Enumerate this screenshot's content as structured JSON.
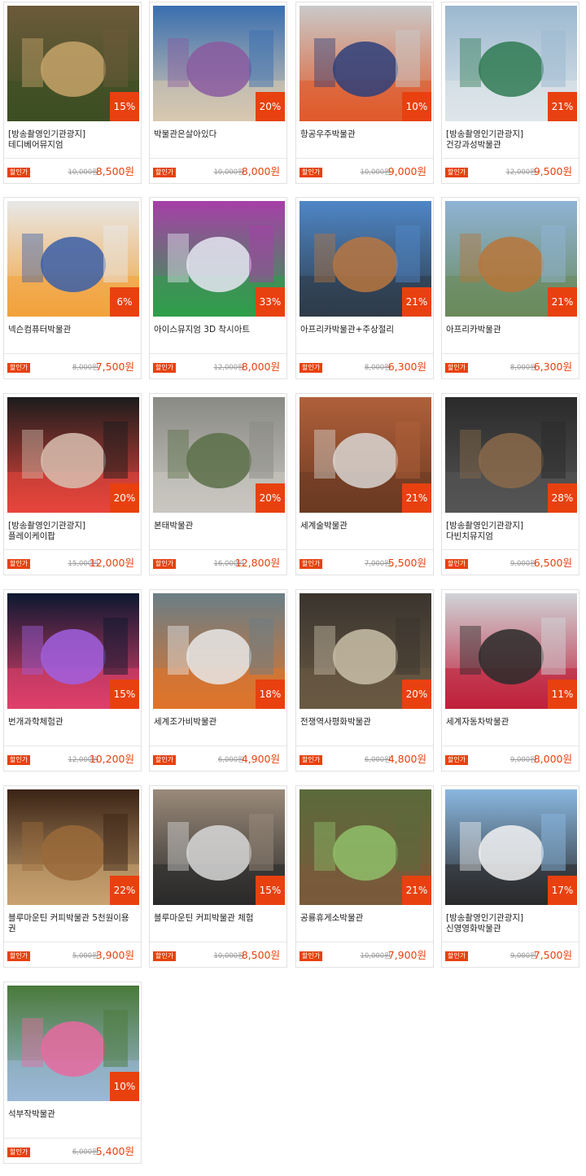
{
  "products": [
    {
      "line1": "[방송촬영인기관광지]",
      "line2": "테디베어뮤지엄",
      "rate": "15%",
      "orig": "10,000원",
      "price": "8,500원",
      "badge": "할인가",
      "image": "teddy-bear-photo",
      "colors": [
        "#6b5a3a",
        "#c7a36a",
        "#3d4f23"
      ]
    },
    {
      "line1": "박물관은살아있다",
      "line2": "",
      "rate": "20%",
      "orig": "10,000원",
      "price": "8,000원",
      "badge": "할인가",
      "image": "octopus-trick-art-photo",
      "colors": [
        "#3a6fb0",
        "#8a5aa0",
        "#d8c9b0"
      ]
    },
    {
      "line1": "항공우주박물관",
      "line2": "",
      "rate": "10%",
      "orig": "10,000원",
      "price": "9,000원",
      "badge": "할인가",
      "image": "aerospace-kids-photo",
      "colors": [
        "#c9c9c9",
        "#2d3f7a",
        "#e05a2a"
      ]
    },
    {
      "line1": "[방송촬영인기관광지]",
      "line2": "건강과성박물관",
      "rate": "21%",
      "orig": "12,000원",
      "price": "9,500원",
      "badge": "할인가",
      "image": "health-museum-building-photo",
      "colors": [
        "#9bb8cf",
        "#2f7a52",
        "#dfe6ea"
      ]
    },
    {
      "line1": "넥슨컴퓨터박물관",
      "line2": "",
      "rate": "6%",
      "orig": "8,000원",
      "price": "7,500원",
      "badge": "할인가",
      "image": "computer-museum-photo",
      "colors": [
        "#e8e8e8",
        "#3a5fa8",
        "#f2a23a"
      ]
    },
    {
      "line1": "아이스뮤지엄 3D 착시아트",
      "line2": "",
      "rate": "33%",
      "orig": "12,000원",
      "price": "8,000원",
      "badge": "할인가",
      "image": "ice-museum-snowman-photo",
      "colors": [
        "#a63fa8",
        "#e6e6f2",
        "#2f9f4a"
      ]
    },
    {
      "line1": "아프리카박물관+주상절리",
      "line2": "",
      "rate": "21%",
      "orig": "8,000원",
      "price": "6,300원",
      "badge": "할인가",
      "image": "africa-museum-coast-photo",
      "colors": [
        "#4f86c6",
        "#b9763f",
        "#2e3b48"
      ]
    },
    {
      "line1": "아프리카박물관",
      "line2": "",
      "rate": "21%",
      "orig": "8,000원",
      "price": "6,300원",
      "badge": "할인가",
      "image": "africa-museum-building-photo",
      "colors": [
        "#8fb3d6",
        "#b8753a",
        "#6a8a5a"
      ]
    },
    {
      "line1": "[방송촬영인기관광지]",
      "line2": "플레이케이팝",
      "rate": "20%",
      "orig": "15,000원",
      "price": "12,000원",
      "badge": "할인가",
      "image": "kpop-star-photo",
      "colors": [
        "#1c1c1c",
        "#d8c0b0",
        "#e8453c"
      ]
    },
    {
      "line1": "본태박물관",
      "line2": "",
      "rate": "20%",
      "orig": "16,000원",
      "price": "12,800원",
      "badge": "할인가",
      "image": "bonte-museum-stairs-photo",
      "colors": [
        "#8a8a84",
        "#5a6e48",
        "#c8c6c0"
      ]
    },
    {
      "line1": "세계술박물관",
      "line2": "",
      "rate": "21%",
      "orig": "7,000원",
      "price": "5,500원",
      "badge": "할인가",
      "image": "liquor-distillery-photo",
      "colors": [
        "#b0603a",
        "#d9d6d2",
        "#6b3a22"
      ]
    },
    {
      "line1": "[방송촬영인기관광지]",
      "line2": "다빈치뮤지엄",
      "rate": "28%",
      "orig": "9,000원",
      "price": "6,500원",
      "badge": "할인가",
      "image": "davinci-exhibit-photo",
      "colors": [
        "#2a2a2a",
        "#8a6a4a",
        "#555555"
      ]
    },
    {
      "line1": "번개과학체험관",
      "line2": "",
      "rate": "15%",
      "orig": "12,000원",
      "price": "10,200원",
      "badge": "할인가",
      "image": "lightning-science-photo",
      "colors": [
        "#0d1830",
        "#a060e0",
        "#e0406a"
      ]
    },
    {
      "line1": "세계조가비박물관",
      "line2": "",
      "rate": "18%",
      "orig": "6,000원",
      "price": "4,900원",
      "badge": "할인가",
      "image": "seashell-coral-photo",
      "colors": [
        "#6a7e86",
        "#e8e8e8",
        "#e0742a"
      ]
    },
    {
      "line1": "전쟁역사평화박물관",
      "line2": "",
      "rate": "20%",
      "orig": "6,000원",
      "price": "4,800원",
      "badge": "할인가",
      "image": "war-history-engine-photo",
      "colors": [
        "#3a342e",
        "#c9bfa8",
        "#6a5a44"
      ]
    },
    {
      "line1": "세계자동차박물관",
      "line2": "",
      "rate": "11%",
      "orig": "9,000원",
      "price": "8,000원",
      "badge": "할인가",
      "image": "classic-car-photo",
      "colors": [
        "#d0d4d8",
        "#2a2a2a",
        "#c0203a"
      ]
    },
    {
      "line1": "블루마운틴 커피박물관 5천원이용",
      "line2": "권",
      "rate": "22%",
      "orig": "5,000원",
      "price": "3,900원",
      "badge": "할인가",
      "image": "coffee-bean-jars-photo",
      "colors": [
        "#3a2416",
        "#9a6a3a",
        "#c8a270"
      ]
    },
    {
      "line1": "블루마운틴 커피박물관 체험",
      "line2": "",
      "rate": "15%",
      "orig": "10,000원",
      "price": "8,500원",
      "badge": "할인가",
      "image": "coffee-roasting-photo",
      "colors": [
        "#9a8a7a",
        "#d8d8d8",
        "#2a2a2a"
      ]
    },
    {
      "line1": "공룡휴게소박물관",
      "line2": "",
      "rate": "21%",
      "orig": "10,000원",
      "price": "7,900원",
      "badge": "할인가",
      "image": "dinosaur-model-photo",
      "colors": [
        "#5a6a3a",
        "#8fbf6a",
        "#7a5a3a"
      ]
    },
    {
      "line1": "[방송촬영인기관광지]",
      "line2": "신영영화박물관",
      "rate": "17%",
      "orig": "9,000원",
      "price": "7,500원",
      "badge": "할인가",
      "image": "film-museum-photo",
      "colors": [
        "#8ab8e0",
        "#f2f2f2",
        "#2a2a2a"
      ]
    },
    {
      "line1": "석부작박물관",
      "line2": "",
      "rate": "10%",
      "orig": "6,000원",
      "price": "5,400원",
      "badge": "할인가",
      "image": "stone-garden-photo",
      "colors": [
        "#4a7a3a",
        "#e86aa0",
        "#9ab8d8"
      ]
    }
  ]
}
